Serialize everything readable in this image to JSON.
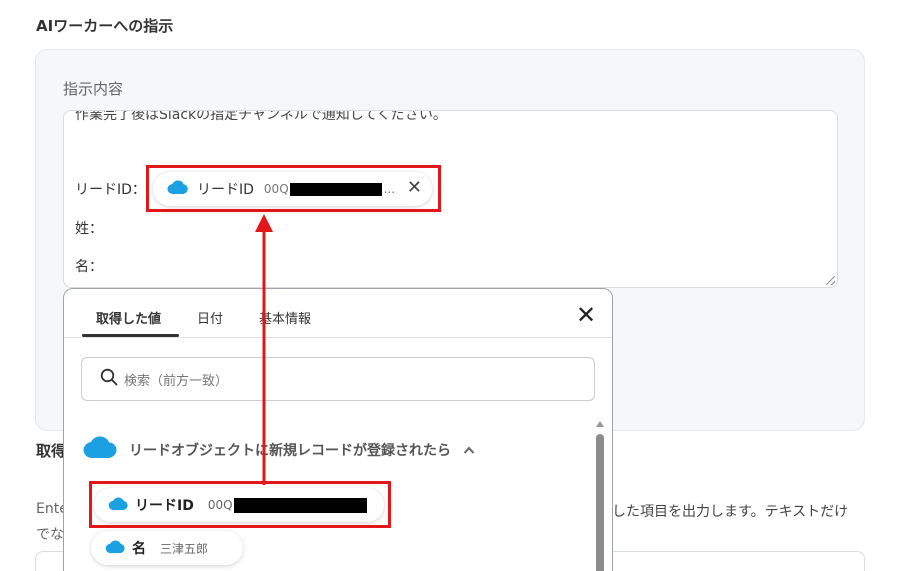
{
  "section": {
    "title": "AIワーカーへの指示"
  },
  "instruction": {
    "label": "指示内容",
    "first_line": "作業完了後はSlackの指定チャンネルで通知してください。",
    "row_lead_id_label": "リードID：",
    "row_last_name_label": "姓：",
    "row_first_name_label": "名："
  },
  "chip": {
    "name": "リードID",
    "value_prefix": "00Q",
    "ellipsis": "..."
  },
  "below": {
    "title": "取得",
    "desc_left": "Ente",
    "desc_left2": "でな",
    "desc_right": "した項目を出力します。テキストだけ"
  },
  "popup": {
    "tabs": [
      {
        "label": "取得した値",
        "active": true
      },
      {
        "label": "日付",
        "active": false
      },
      {
        "label": "基本情報",
        "active": false
      }
    ],
    "close_icon": "close-icon",
    "search_placeholder": "検索（前方一致）",
    "group_label": "リードオブジェクトに新規レコードが登録されたら",
    "items": [
      {
        "name": "リードID",
        "value_prefix": "00Q"
      },
      {
        "name": "名",
        "value": "三津五郎"
      }
    ]
  },
  "colors": {
    "highlight": "#e3171a",
    "salesforce": "#1ba0e2"
  }
}
